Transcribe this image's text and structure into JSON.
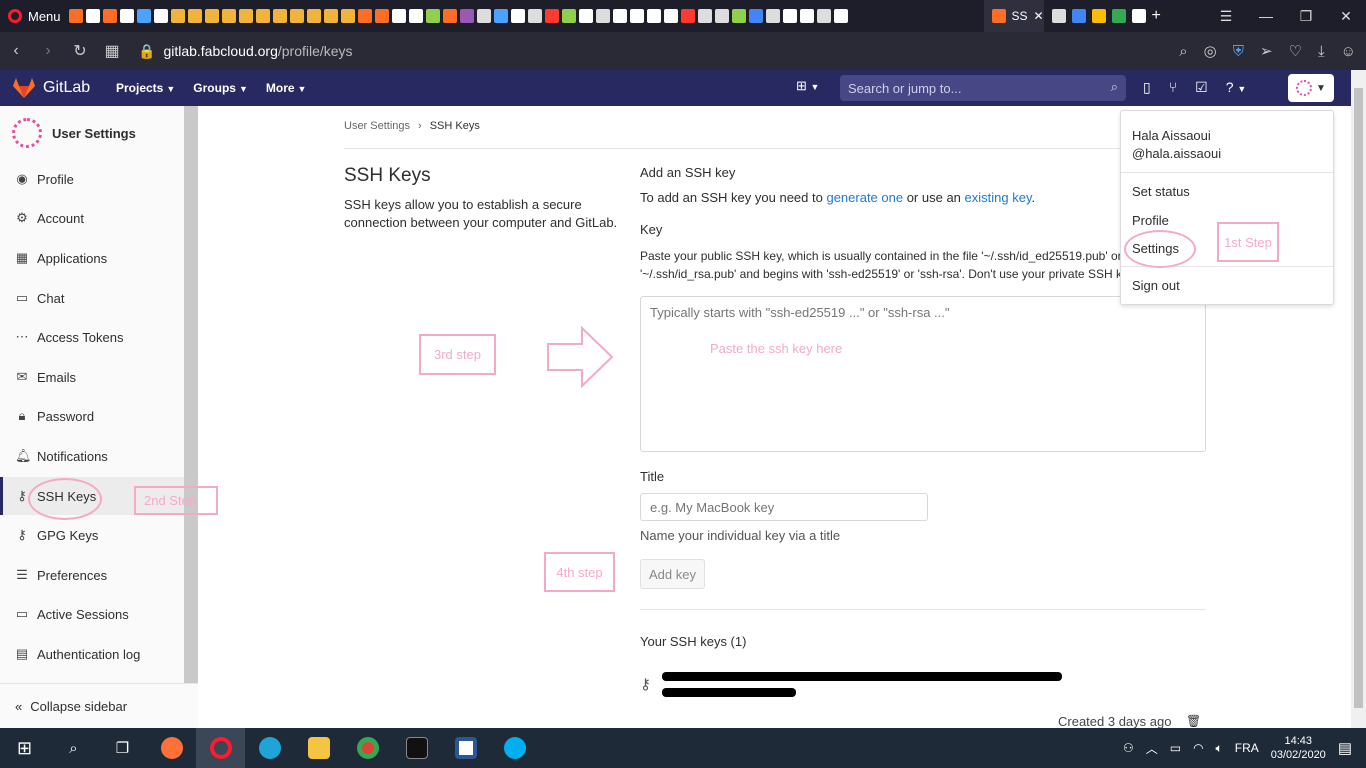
{
  "browser": {
    "menu_label": "Menu",
    "active_tab_title": "SS",
    "url_host": "gitlab.fabcloud.org",
    "url_path": "/profile/keys"
  },
  "header": {
    "brand": "GitLab",
    "nav": [
      "Projects",
      "Groups",
      "More"
    ],
    "search_placeholder": "Search or jump to..."
  },
  "sidebar": {
    "title": "User Settings",
    "items": [
      {
        "label": "Profile",
        "icon": "profile-icon"
      },
      {
        "label": "Account",
        "icon": "account-icon"
      },
      {
        "label": "Applications",
        "icon": "applications-icon"
      },
      {
        "label": "Chat",
        "icon": "chat-icon"
      },
      {
        "label": "Access Tokens",
        "icon": "token-icon"
      },
      {
        "label": "Emails",
        "icon": "mail-icon"
      },
      {
        "label": "Password",
        "icon": "lock-icon"
      },
      {
        "label": "Notifications",
        "icon": "bell-icon"
      },
      {
        "label": "SSH Keys",
        "icon": "key-icon"
      },
      {
        "label": "GPG Keys",
        "icon": "key-icon"
      },
      {
        "label": "Preferences",
        "icon": "preferences-icon"
      },
      {
        "label": "Active Sessions",
        "icon": "monitor-icon"
      },
      {
        "label": "Authentication log",
        "icon": "log-icon"
      }
    ],
    "collapse_label": "Collapse sidebar"
  },
  "breadcrumb": {
    "parent": "User Settings",
    "separator": "›",
    "current": "SSH Keys"
  },
  "main": {
    "left_title": "SSH Keys",
    "left_desc": "SSH keys allow you to establish a secure connection between your computer and GitLab.",
    "add_title": "Add an SSH key",
    "add_desc_1": "To add an SSH key you need to ",
    "add_link_1": "generate one",
    "add_desc_2": " or use an ",
    "add_link_2": "existing key",
    "add_desc_3": ".",
    "key_label": "Key",
    "key_help_1": "Paste your public SSH key, which is usually contained in the file '~/.ssh/id_ed25519.pub' or",
    "key_help_2": "'~/.ssh/id_rsa.pub' and begins with 'ssh-ed25519' or 'ssh-rsa'. Don't use your private SSH key.",
    "key_placeholder": "Typically starts with \"ssh-ed25519 ...\" or \"ssh-rsa ...\"",
    "title_label": "Title",
    "title_placeholder": "e.g. My MacBook key",
    "title_help": "Name your individual key via a title",
    "add_button": "Add key",
    "your_keys": "Your SSH keys (1)",
    "created": "Created 3 days ago"
  },
  "dropdown": {
    "name": "Hala Aissaoui",
    "handle": "@hala.aissaoui",
    "items": [
      "Set status",
      "Profile",
      "Settings",
      "Sign out"
    ]
  },
  "annotations": {
    "step1": "1st Step",
    "step2": "2nd Step",
    "step3": "3rd step",
    "step4": "4th step",
    "paste_hint": "Paste the ssh key here"
  },
  "taskbar": {
    "lang": "FRA",
    "time": "14:43",
    "date": "03/02/2020"
  },
  "colors": {
    "gitlab_header": "#292961",
    "annotation_pink": "#f5a9c9",
    "link": "#1f78d1"
  }
}
